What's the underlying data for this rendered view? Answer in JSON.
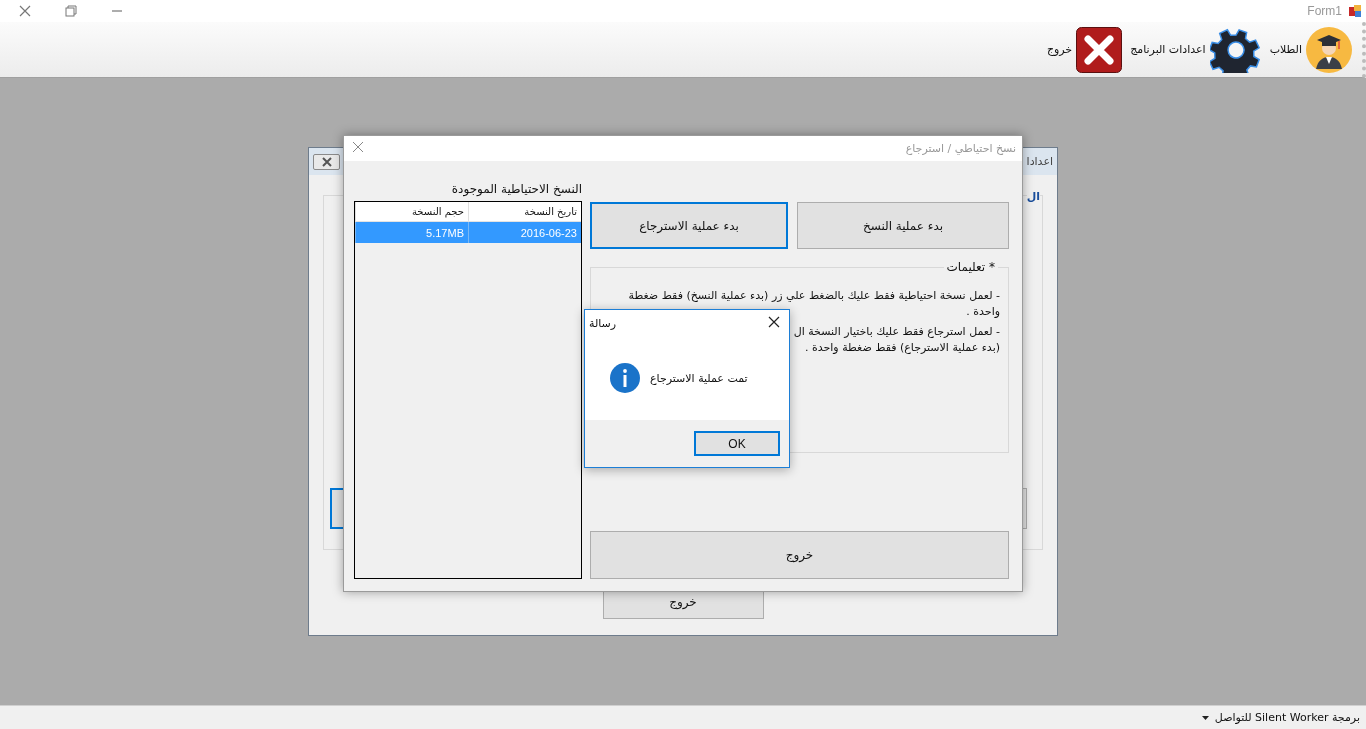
{
  "window": {
    "title": "Form1"
  },
  "toolbar": {
    "items": [
      {
        "label": "الطلاب",
        "kind": "students"
      },
      {
        "label": "اعدادات البرنامج",
        "kind": "settings"
      },
      {
        "label": "خروج",
        "kind": "exit"
      }
    ]
  },
  "background_window": {
    "title": "اعدادا",
    "group_label": "ال",
    "exit_button": "خروج"
  },
  "backup_dialog": {
    "title": "نسخ احتياطي / استرجاع",
    "list_label": "النسخ الاحتياطية الموجودة",
    "table": {
      "columns": [
        "تاريخ النسخة",
        "حجم النسخة"
      ],
      "rows": [
        {
          "cells": [
            "2016-06-23",
            "5.17MB"
          ],
          "selected": true
        }
      ]
    },
    "buttons": [
      {
        "label": "بدء عملية النسخ",
        "focused": false
      },
      {
        "label": "بدء عملية الاسترجاع",
        "focused": true
      }
    ],
    "instructions": {
      "title": "* تعليمات",
      "paragraphs": [
        "- لعمل نسخة احتياطية فقط عليك بالضغط علي زر (بدء عملية النسخ) فقط ضغطة واحدة .",
        "- لعمل استرجاع فقط عليك باختيار النسخة ال",
        "(بدء عملية الاسترجاع) فقط ضغطة واحدة ."
      ]
    },
    "exit_button": "خروج"
  },
  "message_box": {
    "title": "رسالة",
    "message": "تمت عملية الاسترجاع",
    "buttons": [
      {
        "label": "OK",
        "focused": true
      }
    ]
  },
  "status_bar": {
    "dropdown": "برمجة Silent Worker للتواصل"
  }
}
